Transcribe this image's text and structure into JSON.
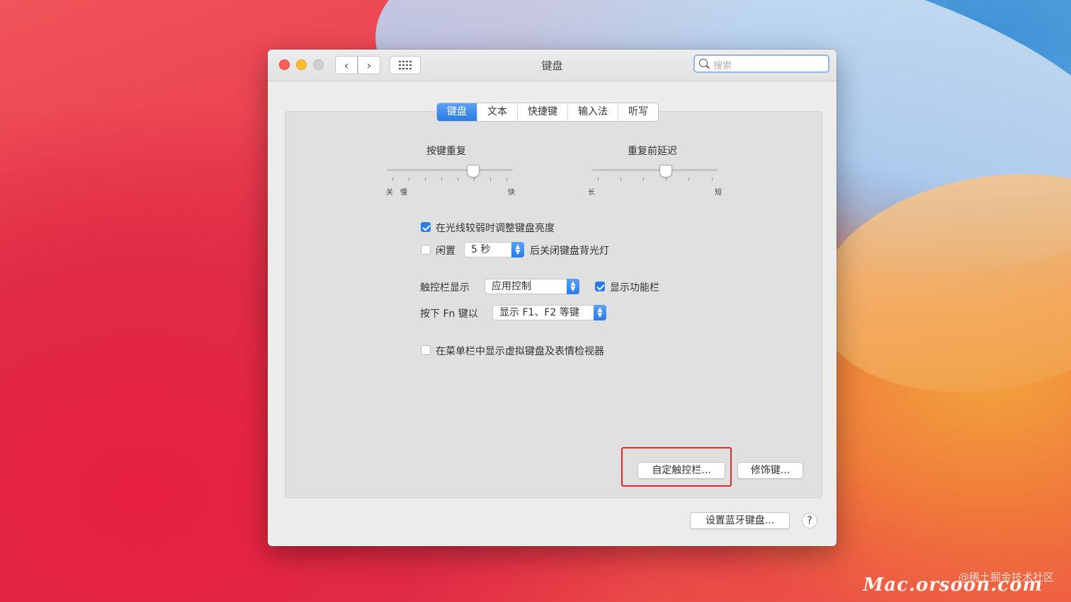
{
  "window": {
    "title": "键盘",
    "search_placeholder": "搜索"
  },
  "tabs": [
    {
      "label": "键盘",
      "selected": true
    },
    {
      "label": "文本",
      "selected": false
    },
    {
      "label": "快捷键",
      "selected": false
    },
    {
      "label": "输入法",
      "selected": false
    },
    {
      "label": "听写",
      "selected": false
    }
  ],
  "sliders": {
    "key_repeat": {
      "label": "按键重复",
      "min_labels": [
        "关",
        "慢"
      ],
      "max_label": "快",
      "level": 0.68
    },
    "delay_until_repeat": {
      "label": "重复前延迟",
      "min_label": "长",
      "max_label": "短",
      "level": 0.58
    }
  },
  "options": {
    "adjust_brightness": {
      "label": "在光线较弱时调整键盘亮度",
      "checked": true
    },
    "backlight_off": {
      "prefix": "闲置",
      "value": "5 秒",
      "suffix": "后关闭键盘背光灯",
      "checked": false
    },
    "touchbar_shows": {
      "label": "触控栏显示",
      "value": "应用控制"
    },
    "show_control_strip": {
      "label": "显示功能栏",
      "checked": true
    },
    "press_fn": {
      "label": "按下 Fn 键以",
      "value": "显示 F1、F2 等键"
    },
    "show_keyboard_viewer": {
      "label": "在菜单栏中显示虚拟键盘及表情检视器",
      "checked": false
    }
  },
  "buttons": {
    "customize_touchbar": "自定触控栏...",
    "modifier_keys": "修饰键...",
    "bluetooth_keyboard": "设置蓝牙键盘...",
    "help": "?"
  },
  "watermark": {
    "community": "@稀土掘金技术社区",
    "site": "Mac.orsoon.com"
  },
  "colors": {
    "accent": "#2a7be8",
    "highlight_box": "#e3282c",
    "close": "#ff5f57",
    "minimize": "#febc2e"
  }
}
